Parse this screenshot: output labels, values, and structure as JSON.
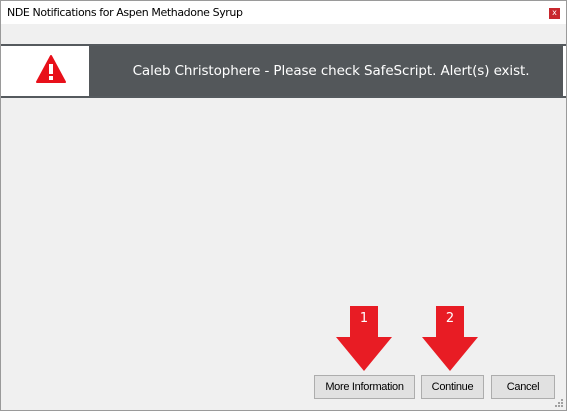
{
  "window": {
    "title": "NDE Notifications for Aspen Methadone Syrup",
    "close_label": "x"
  },
  "alert": {
    "icon": "warning-icon",
    "message": "Caleb Christophere - Please check SafeScript. Alert(s) exist."
  },
  "annotations": [
    {
      "label": "1",
      "icon": "arrow-down-icon"
    },
    {
      "label": "2",
      "icon": "arrow-down-icon"
    }
  ],
  "buttons": {
    "more_info": "More Information",
    "continue": "Continue",
    "cancel": "Cancel"
  },
  "colors": {
    "banner_bg": "#53575a",
    "warning_red": "#e8101a",
    "marker_red": "#e81c24",
    "close_red": "#c8272d"
  }
}
